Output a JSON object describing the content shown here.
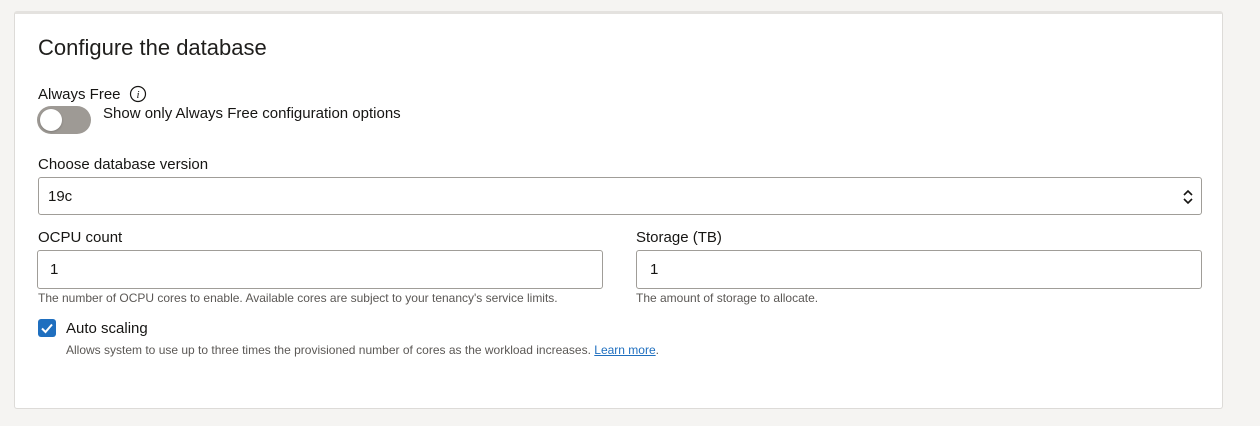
{
  "section": {
    "title": "Configure the database"
  },
  "always_free": {
    "label": "Always Free",
    "info_icon": "info-icon",
    "toggle_label": "Show only Always Free configuration options",
    "toggle_on": false
  },
  "db_version": {
    "label": "Choose database version",
    "value": "19c",
    "chevron_icon": "chevron-up-down-icon"
  },
  "ocpu": {
    "label": "OCPU count",
    "value": "1",
    "hint": "The number of OCPU cores to enable. Available cores are subject to your tenancy's service limits."
  },
  "storage": {
    "label": "Storage (TB)",
    "value": "1",
    "hint": "The amount of storage to allocate."
  },
  "auto_scaling": {
    "label": "Auto scaling",
    "checked": true,
    "hint": "Allows system to use up to three times the provisioned number of cores as the workload increases.",
    "link": "Learn more",
    "hint_end": "."
  },
  "colors": {
    "accent": "#1f6fbf",
    "toggle_off": "#9e9a95"
  }
}
